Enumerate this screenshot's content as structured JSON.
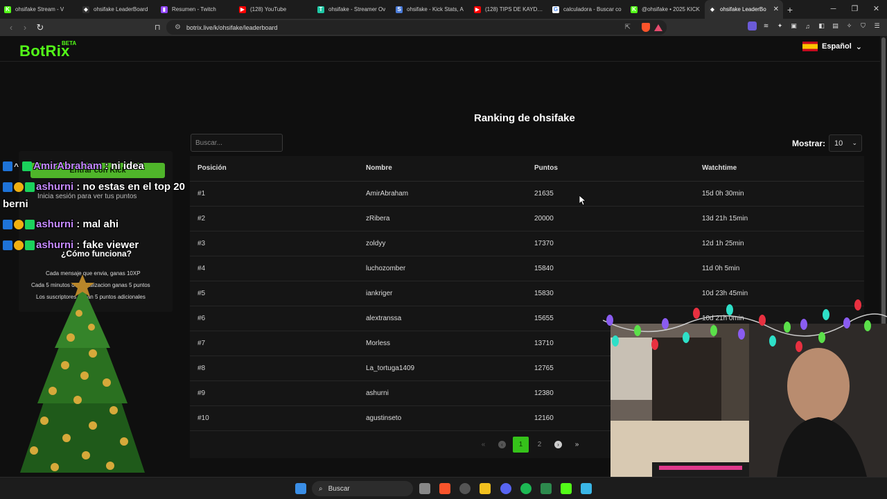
{
  "browser": {
    "tabs": [
      {
        "title": "ohsifake Stream - V",
        "color": "#53fc18",
        "glyph": "K"
      },
      {
        "title": "ohsifake LeaderBoard",
        "color": "#333333",
        "glyph": "◆"
      },
      {
        "title": "Resumen - Twitch",
        "color": "#9146ff",
        "glyph": "▮"
      },
      {
        "title": "(128) YouTube",
        "color": "#ff0000",
        "glyph": "▶"
      },
      {
        "title": "ohsifake - Streamer Ov",
        "color": "#1ec8a5",
        "glyph": "T"
      },
      {
        "title": "ohsifake - Kick Stats, A",
        "color": "#4a7bd8",
        "glyph": "S"
      },
      {
        "title": "(128) TIPS DE KAYDY P",
        "color": "#ff0000",
        "glyph": "▶"
      },
      {
        "title": "calculadora - Buscar co",
        "color": "#ffffff",
        "glyph": "G"
      },
      {
        "title": "@ohsifake • 2025 KICK",
        "color": "#53fc18",
        "glyph": "K"
      },
      {
        "title": "ohsifake LeaderBo",
        "color": "#333333",
        "glyph": "◆",
        "active": true
      }
    ],
    "new_tab": "+",
    "window_controls": [
      "─",
      "❐",
      "✕"
    ],
    "url": "botrix.live/k/ohsifake/leaderboard"
  },
  "site": {
    "logo": "BotRix",
    "beta": "BETA",
    "language": "Español"
  },
  "leaderboard": {
    "title": "Ranking de ohsifake",
    "search_placeholder": "Buscar...",
    "show_label": "Mostrar:",
    "show_value": "10",
    "columns": [
      "Posición",
      "Nombre",
      "Puntos",
      "Watchtime"
    ],
    "rows": [
      {
        "pos": "#1",
        "name": "AmirAbraham",
        "points": "21635",
        "watchtime": "15d 0h 30min"
      },
      {
        "pos": "#2",
        "name": "zRibera",
        "points": "20000",
        "watchtime": "13d 21h 15min"
      },
      {
        "pos": "#3",
        "name": "zoldyy",
        "points": "17370",
        "watchtime": "12d 1h 25min"
      },
      {
        "pos": "#4",
        "name": "luchozomber",
        "points": "15840",
        "watchtime": "11d 0h 5min"
      },
      {
        "pos": "#5",
        "name": "iankriger",
        "points": "15830",
        "watchtime": "10d 23h 45min"
      },
      {
        "pos": "#6",
        "name": "alextranssa",
        "points": "15655",
        "watchtime": "10d 21h 0min"
      },
      {
        "pos": "#7",
        "name": "Morless",
        "points": "13710",
        "watchtime": ""
      },
      {
        "pos": "#8",
        "name": "La_tortuga1409",
        "points": "12765",
        "watchtime": ""
      },
      {
        "pos": "#9",
        "name": "ashurni",
        "points": "12380",
        "watchtime": ""
      },
      {
        "pos": "#10",
        "name": "agustinseto",
        "points": "12160",
        "watchtime": ""
      }
    ],
    "pagination": {
      "first": "«",
      "prev": "‹",
      "pages": [
        "1",
        "2"
      ],
      "current": "1",
      "next": "›",
      "last": "»"
    }
  },
  "sidebar": {
    "kick_button": "Entrar con Kick",
    "login_note": "Inicia sesión para ver tus puntos",
    "how_title": "¿Cómo funciona?",
    "how_lines": [
      "Cada mensaje que envia, ganas 10XP",
      "Cada 5 minutos de visualizacion ganas 5 puntos",
      "Los suscriptores ganan 5 puntos adicionales"
    ]
  },
  "chat": [
    {
      "user": "AmirAbraham",
      "message": "ni idea",
      "badges": [
        "blue",
        "slash",
        "green"
      ]
    },
    {
      "user": "ashurni",
      "message": "no estas en el top 20",
      "badges": [
        "blue",
        "gold",
        "green"
      ]
    },
    {
      "user": "",
      "message": "berni",
      "badges": []
    },
    {
      "user": "ashurni",
      "message": "mal ahi",
      "badges": [
        "blue",
        "gold",
        "green"
      ]
    },
    {
      "user": "ashurni",
      "message": "fake viewer",
      "badges": [
        "blue",
        "gold",
        "green"
      ]
    }
  ],
  "taskbar": {
    "search_label": "Buscar"
  },
  "colors": {
    "kick_green": "#53fc18",
    "page_bg": "#0f0f0f",
    "chat_username": "#c58aff"
  }
}
